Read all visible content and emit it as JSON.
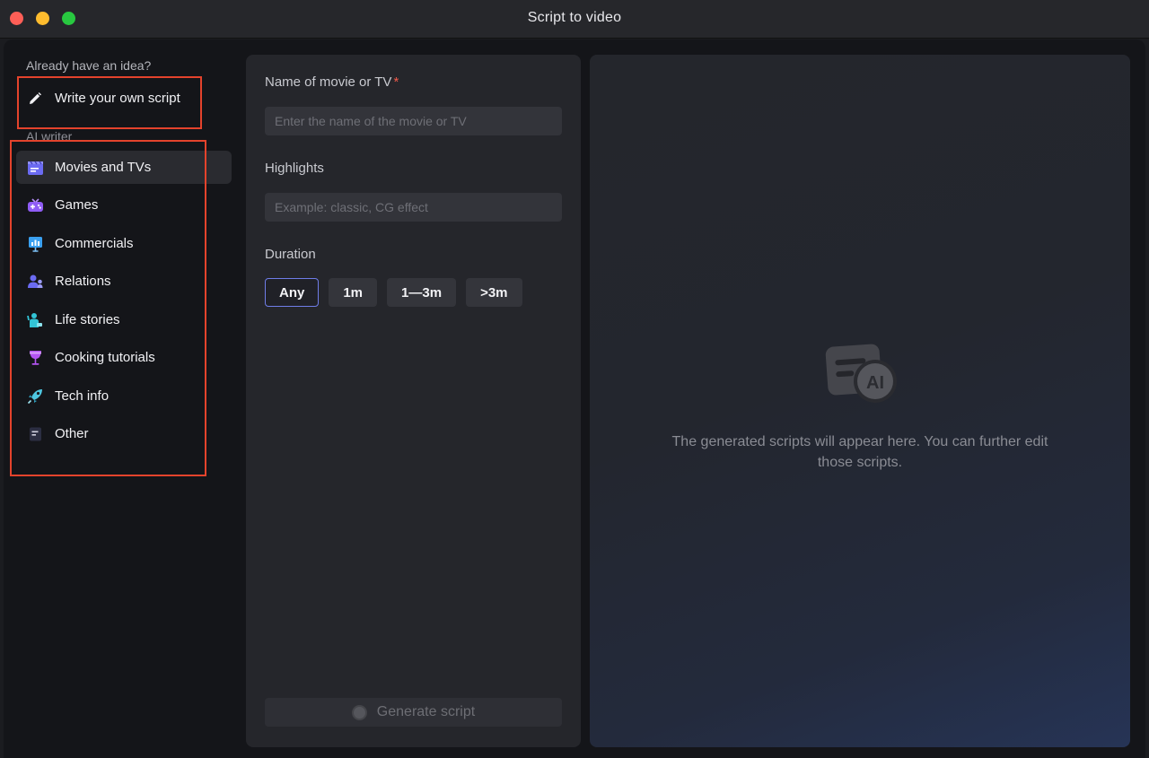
{
  "window": {
    "title": "Script to video"
  },
  "sidebar": {
    "own_idea_label": "Already have an idea?",
    "write_own": {
      "label": "Write your own script",
      "icon": "pencil-icon"
    },
    "ai_writer_label": "AI writer",
    "items": [
      {
        "label": "Movies and TVs",
        "icon": "clapperboard-icon",
        "color": "#6b6bf2",
        "active": true
      },
      {
        "label": "Games",
        "icon": "gamepad-icon",
        "color": "#8f5cf5"
      },
      {
        "label": "Commercials",
        "icon": "presentation-icon",
        "color": "#3aa0f0"
      },
      {
        "label": "Relations",
        "icon": "people-icon",
        "color": "#6b6bf2"
      },
      {
        "label": "Life stories",
        "icon": "person-icon",
        "color": "#32c4d6"
      },
      {
        "label": "Cooking tutorials",
        "icon": "goblet-icon",
        "color": "#b354f2"
      },
      {
        "label": "Tech info",
        "icon": "rocket-icon",
        "color": "#4ec6e0"
      },
      {
        "label": "Other",
        "icon": "document-icon",
        "color": "#3a3c54"
      }
    ]
  },
  "form": {
    "name_label": "Name of movie or TV",
    "required_mark": "*",
    "name_placeholder": "Enter the name of the movie or TV",
    "highlights_label": "Highlights",
    "highlights_placeholder": "Example: classic, CG effect",
    "duration_label": "Duration",
    "durations": [
      "Any",
      "1m",
      "1—3m",
      ">3m"
    ],
    "selected_duration": "Any",
    "generate_label": "Generate script"
  },
  "output": {
    "empty_icon": "ai-script-icon",
    "empty_text": "The generated scripts will appear here. You can further edit those scripts."
  },
  "colors": {
    "accent": "#6f7de8",
    "annotation": "#e4432c",
    "required": "#f15a4a"
  }
}
